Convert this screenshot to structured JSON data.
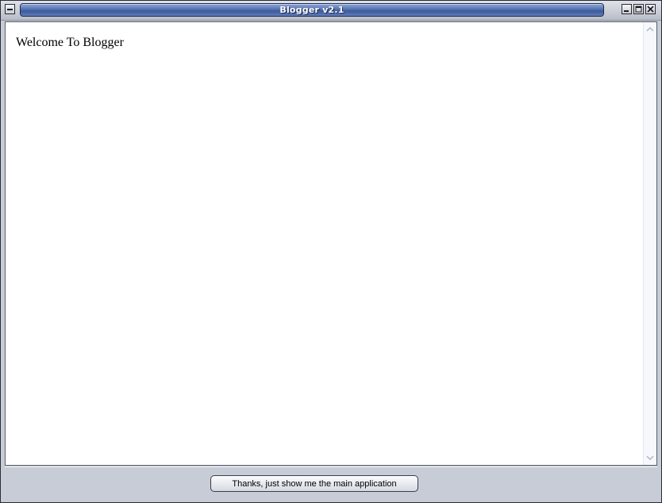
{
  "window": {
    "title": "Blogger v2.1"
  },
  "content": {
    "welcome_text": "Welcome To Blogger"
  },
  "footer": {
    "main_button_label": "Thanks, just show me the main application"
  },
  "colors": {
    "title_bar_accent": "#4f6cab",
    "window_chrome": "#c8ccd6",
    "content_background": "#ffffff"
  },
  "icons": {
    "system_menu": "window-menu-icon",
    "minimize": "minimize-icon",
    "maximize": "maximize-icon",
    "close": "close-icon",
    "scroll_up": "chevron-up-icon",
    "scroll_down": "chevron-down-icon"
  }
}
